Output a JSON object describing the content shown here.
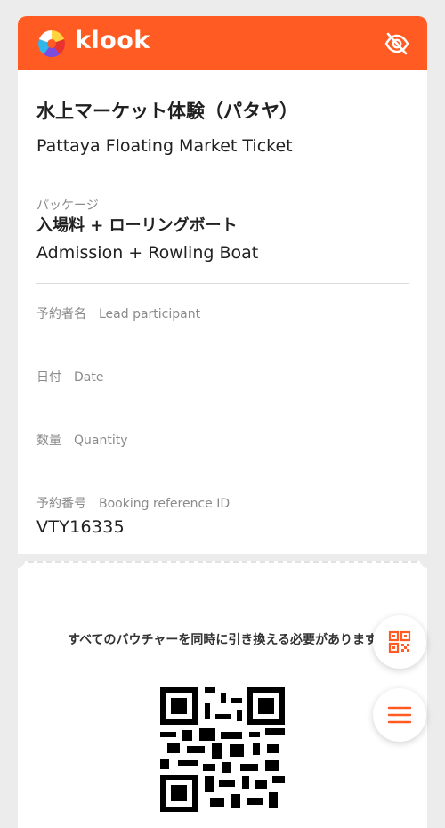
{
  "header": {
    "brand": "klook",
    "brand_color": "#ff5b22",
    "logo_icon": "klook-logo-icon",
    "visibility_icon": "eye-off-icon"
  },
  "product": {
    "title_ja": "水上マーケット体験（パタヤ）",
    "title_en": "Pattaya Floating Market Ticket"
  },
  "package": {
    "label": "パッケージ",
    "name_ja": "入場料 + ローリングボート",
    "name_en": "Admission + Rowling Boat"
  },
  "fields": {
    "lead_label": "予約者名　Lead participant",
    "date_label": "日付　Date",
    "quantity_label": "数量　Quantity",
    "booking_label": "予約番号　Booking reference ID",
    "booking_id": "VTY16335"
  },
  "voucher": {
    "notice": "すべてのバウチャーを同時に引き換える必要があります"
  },
  "fabs": {
    "qr_icon": "qr-code-icon",
    "menu_icon": "menu-icon",
    "accent": "#ff5b22"
  }
}
